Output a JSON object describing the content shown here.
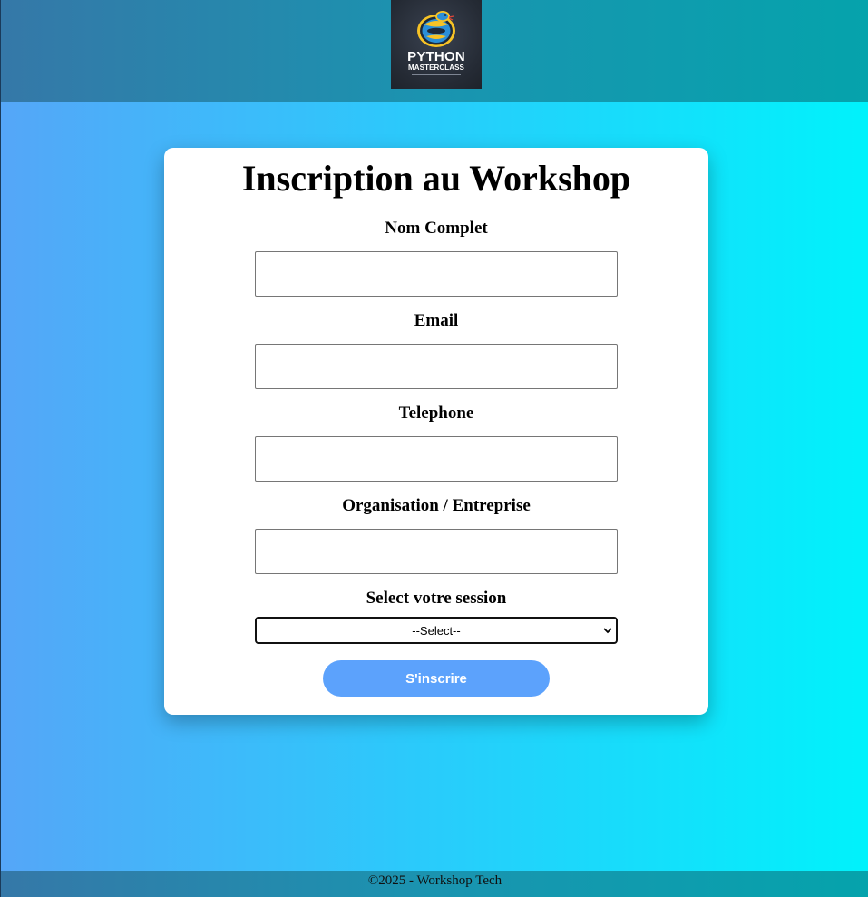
{
  "header": {
    "logo": {
      "icon": "python-snake-icon",
      "title": "PYTHON",
      "subtitle": "MASTERCLASS"
    }
  },
  "form": {
    "title": "Inscription au Workshop",
    "fields": [
      {
        "label": "Nom Complet",
        "value": "",
        "placeholder": ""
      },
      {
        "label": "Email",
        "value": "",
        "placeholder": ""
      },
      {
        "label": "Telephone",
        "value": "",
        "placeholder": ""
      },
      {
        "label": "Organisation / Entreprise",
        "value": "",
        "placeholder": ""
      }
    ],
    "session": {
      "label": "Select votre session",
      "selected": "--Select--"
    },
    "submit_label": "S'inscrire"
  },
  "footer": {
    "text": "©2025 - Workshop Tech"
  },
  "colors": {
    "button": "#5ca2fc",
    "logo_yellow": "#f7c325",
    "logo_blue": "#2a8fd8"
  }
}
